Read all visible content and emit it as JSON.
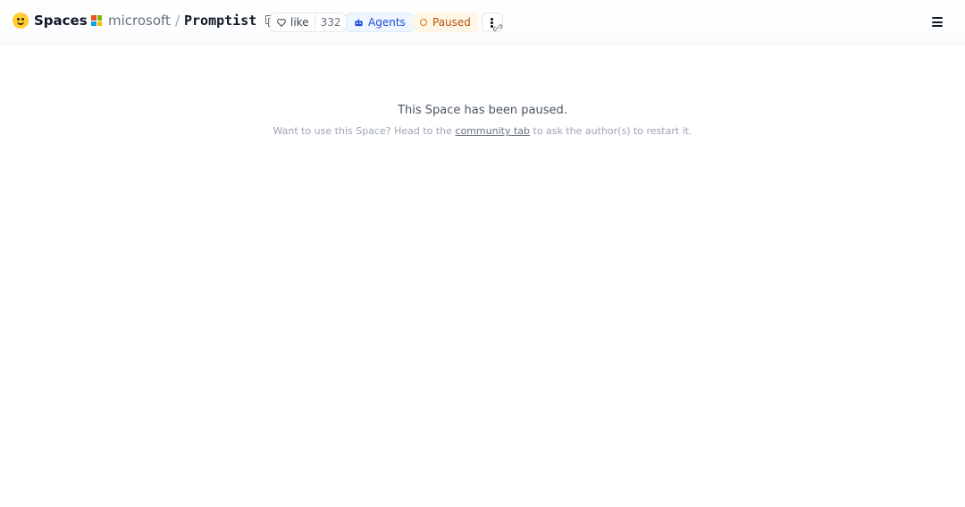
{
  "header": {
    "brand_label": "Spaces",
    "owner": "microsoft",
    "separator": "/",
    "repo_name": "Promptist",
    "like_label": "like",
    "like_count": "332",
    "agents_label": "Agents",
    "status_label": "Paused",
    "icons": {
      "brand": "hugging-face-logo-icon",
      "owner": "microsoft-logo-icon",
      "copy": "copy-icon",
      "like": "heart-icon",
      "agents": "robot-icon",
      "status": "pause-circle-icon",
      "more": "more-vertical-icon",
      "link": "link-icon",
      "menu": "hamburger-menu-icon"
    },
    "colors": {
      "agents_text": "#1d4ed8",
      "agents_bg": "#eff6ff",
      "paused_text": "#b45309",
      "paused_bg": "#fef7e8"
    }
  },
  "main": {
    "title": "This Space has been paused.",
    "message_prefix": "Want to use this Space? Head to the",
    "community_link": "community tab",
    "message_suffix": "to ask the author(s) to restart it."
  }
}
